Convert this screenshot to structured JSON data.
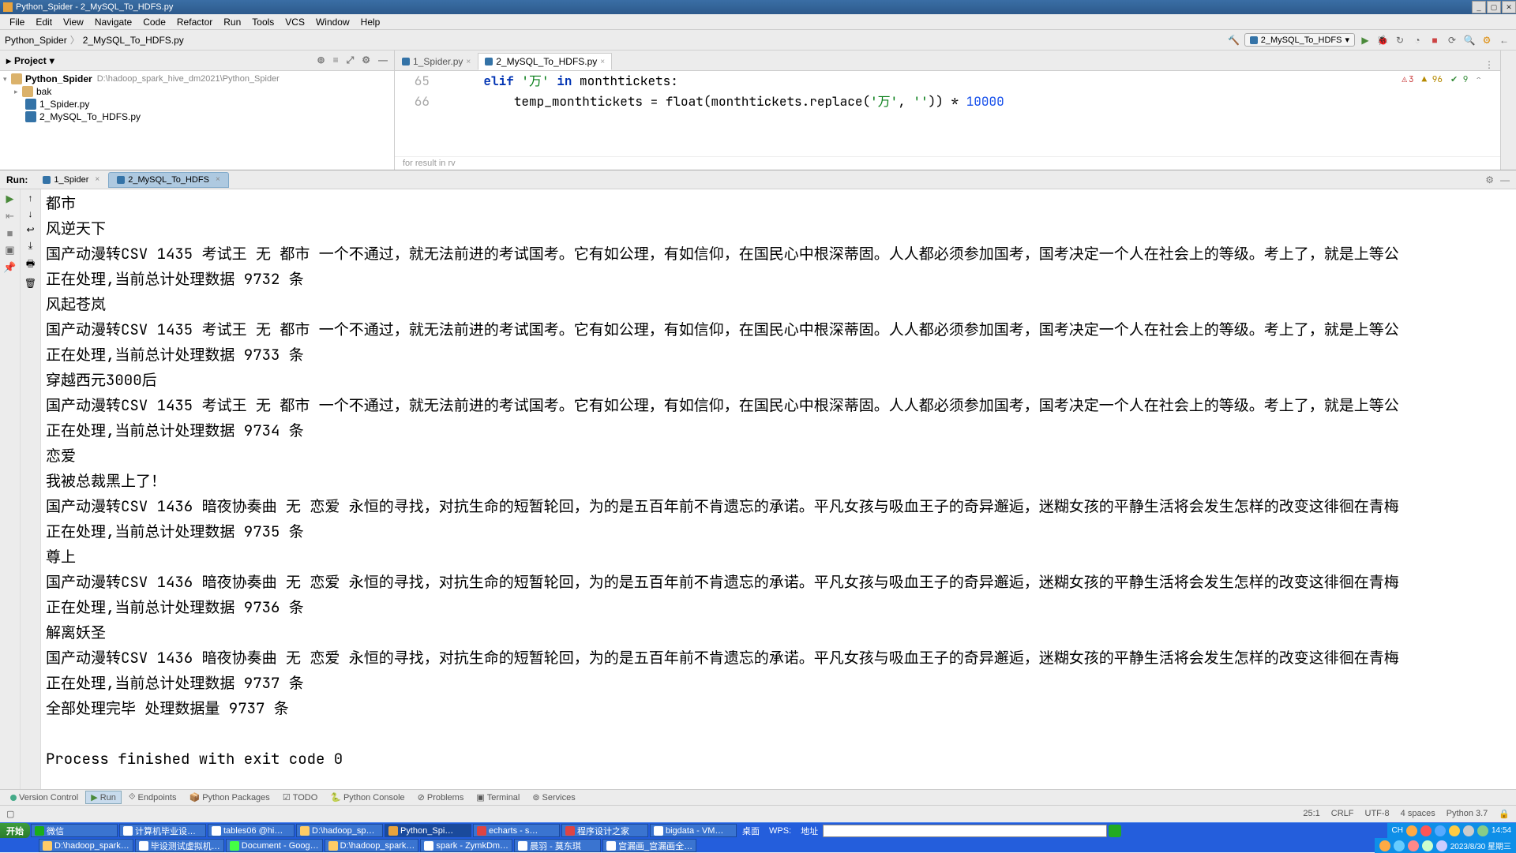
{
  "title": "Python_Spider - 2_MySQL_To_HDFS.py",
  "menu": [
    "File",
    "Edit",
    "View",
    "Navigate",
    "Code",
    "Refactor",
    "Run",
    "Tools",
    "VCS",
    "Window",
    "Help"
  ],
  "breadcrumb": [
    "Python_Spider",
    "2_MySQL_To_HDFS.py"
  ],
  "run_config": "2_MySQL_To_HDFS",
  "project": {
    "title": "Project",
    "root": "Python_Spider",
    "root_path": "D:\\hadoop_spark_hive_dm2021\\Python_Spider",
    "bak": "bak",
    "files": [
      "1_Spider.py",
      "2_MySQL_To_HDFS.py"
    ]
  },
  "editor_tabs": [
    {
      "name": "1_Spider.py",
      "active": false
    },
    {
      "name": "2_MySQL_To_HDFS.py",
      "active": true
    }
  ],
  "code": {
    "ln1": "65",
    "ln2": "66",
    "line1_kw": "elif",
    "line1_str": "'万'",
    "line1_in": "in",
    "line1_rest": "monthtickets:",
    "line2_var": "temp_monthtickets",
    "line2_eq": "=",
    "line2_fn": "float",
    "line2_arg": "(monthtickets.replace(",
    "line2_s1": "'万'",
    "line2_c": ", ",
    "line2_s2": "''",
    "line2_close": ")) * ",
    "line2_num": "10000",
    "bc": "for result in rv"
  },
  "inspections": {
    "err": "3",
    "warn": "96",
    "weak": "9"
  },
  "run": {
    "label": "Run:",
    "tabs": [
      {
        "name": "1_Spider"
      },
      {
        "name": "2_MySQL_To_HDFS"
      }
    ],
    "lines": [
      "都市",
      "风逆天下",
      "国产动漫转CSV 1435 考试王 无 都市 一个不通过，就无法前进的考试国考。它有如公理，有如信仰，在国民心中根深蒂固。人人都必须参加国考，国考决定一个人在社会上的等级。考上了，就是上等公",
      "正在处理,当前总计处理数据 9732 条",
      "风起苍岚",
      "国产动漫转CSV 1435 考试王 无 都市 一个不通过，就无法前进的考试国考。它有如公理，有如信仰，在国民心中根深蒂固。人人都必须参加国考，国考决定一个人在社会上的等级。考上了，就是上等公",
      "正在处理,当前总计处理数据 9733 条",
      "穿越西元3000后",
      "国产动漫转CSV 1435 考试王 无 都市 一个不通过，就无法前进的考试国考。它有如公理，有如信仰，在国民心中根深蒂固。人人都必须参加国考，国考决定一个人在社会上的等级。考上了，就是上等公",
      "正在处理,当前总计处理数据 9734 条",
      "恋爱",
      "我被总裁黑上了！",
      "国产动漫转CSV 1436 暗夜协奏曲 无 恋爱 永恒的寻找，对抗生命的短暂轮回，为的是五百年前不肯遗忘的承诺。平凡女孩与吸血王子的奇异邂逅，迷糊女孩的平静生活将会发生怎样的改变这徘徊在青梅",
      "正在处理,当前总计处理数据 9735 条",
      "尊上",
      "国产动漫转CSV 1436 暗夜协奏曲 无 恋爱 永恒的寻找，对抗生命的短暂轮回，为的是五百年前不肯遗忘的承诺。平凡女孩与吸血王子的奇异邂逅，迷糊女孩的平静生活将会发生怎样的改变这徘徊在青梅",
      "正在处理,当前总计处理数据 9736 条",
      "解离妖圣",
      "国产动漫转CSV 1436 暗夜协奏曲 无 恋爱 永恒的寻找，对抗生命的短暂轮回，为的是五百年前不肯遗忘的承诺。平凡女孩与吸血王子的奇异邂逅，迷糊女孩的平静生活将会发生怎样的改变这徘徊在青梅",
      "正在处理,当前总计处理数据 9737 条",
      "全部处理完毕 处理数据量 9737 条",
      "",
      "Process finished with exit code 0"
    ]
  },
  "bottom_tools": [
    "Version Control",
    "Run",
    "Endpoints",
    "Python Packages",
    "TODO",
    "Python Console",
    "Problems",
    "Terminal",
    "Services"
  ],
  "status": {
    "pos": "25:1",
    "eol": "CRLF",
    "enc": "UTF-8",
    "indent": "4 spaces",
    "interp": "Python 3.7"
  },
  "taskbar": {
    "start": "开始",
    "row1": [
      "微信",
      "计算机毕业设…",
      "tables06 @hi…",
      "D:\\hadoop_sp…",
      "Python_Spi…",
      "echarts - s…",
      "程序设计之家",
      "bigdata - VM…"
    ],
    "desktop": "桌面",
    "wps": "WPS: ",
    "addr": "地址",
    "row2": [
      "D:\\hadoop_spark…",
      "毕设测试虚拟机…",
      "Document - Goog…",
      "D:\\hadoop_spark…",
      "spark - ZymkDm…",
      "晨羽 - 莫东琪",
      "宫漏画_宫漏画全…"
    ],
    "tray_lang": "CH",
    "time": "14:54",
    "date": "2023/8/30 星期三"
  }
}
